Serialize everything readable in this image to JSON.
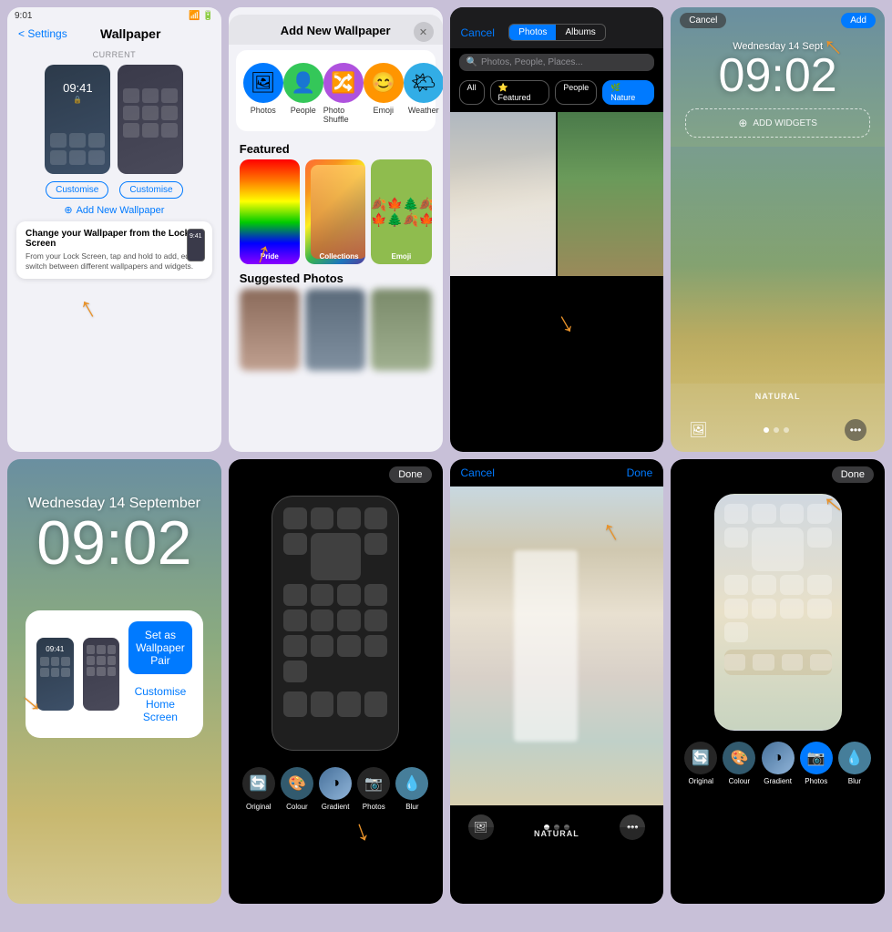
{
  "app": {
    "background": "#c8c0d8"
  },
  "cell1": {
    "status_time": "9:01",
    "nav_back": "< Settings",
    "nav_title": "Wallpaper",
    "current_label": "CURRENT",
    "lock_time": "09:41",
    "customise_left": "Customise",
    "customise_right": "Customise",
    "add_new": "Add New Wallpaper",
    "tooltip_title": "Change your Wallpaper from the Lock Screen",
    "tooltip_body": "From your Lock Screen, tap and hold to add, edit or switch between different wallpapers and widgets.",
    "tooltip_time": "9:41"
  },
  "cell2": {
    "title": "Add New Wallpaper",
    "close_icon": "×",
    "icons": [
      {
        "label": "Photos",
        "emoji": "🖼",
        "bg": "#007aff"
      },
      {
        "label": "People",
        "emoji": "👤",
        "bg": "#34c759"
      },
      {
        "label": "Photo Shuffle",
        "emoji": "🔀",
        "bg": "#af52de"
      },
      {
        "label": "Emoji",
        "emoji": "😊",
        "bg": "#ff9500"
      },
      {
        "label": "Weather",
        "emoji": "🌤",
        "bg": "#32ade6"
      }
    ],
    "featured_label": "Featured",
    "featured": [
      {
        "label": "Pride"
      },
      {
        "label": "Collections"
      },
      {
        "label": "Emoji"
      }
    ],
    "suggested_label": "Suggested Photos"
  },
  "cell3": {
    "cancel": "Cancel",
    "tab_photos": "Photos",
    "tab_albums": "Albums",
    "search_placeholder": "Photos, People, Places...",
    "filters": [
      "All",
      "Featured",
      "People",
      "Nature"
    ],
    "active_filter": "Nature"
  },
  "cell4": {
    "cancel": "Cancel",
    "add": "Add",
    "date": "Wednesday 14 Sept",
    "time": "09:02",
    "widget_text": "ADD WIDGETS",
    "natural_label": "NATURAL",
    "dots": 3,
    "active_dot": 0
  },
  "cell5": {
    "date": "Wednesday 14 September",
    "time": "09:02",
    "btn_pair": "Set as Wallpaper Pair",
    "btn_customise": "Customise Home Screen"
  },
  "cell6": {
    "done": "Done"
  },
  "cell7": {
    "cancel": "Cancel",
    "done": "Done",
    "natural_badge": "NATURAL"
  },
  "cell8": {
    "done": "Done",
    "options": [
      "Original",
      "Colour",
      "Gradient",
      "Photos",
      "Blur"
    ]
  },
  "toolbar6": {
    "options": [
      "Original",
      "Colour",
      "Gradient",
      "Photos",
      "Blur"
    ]
  }
}
